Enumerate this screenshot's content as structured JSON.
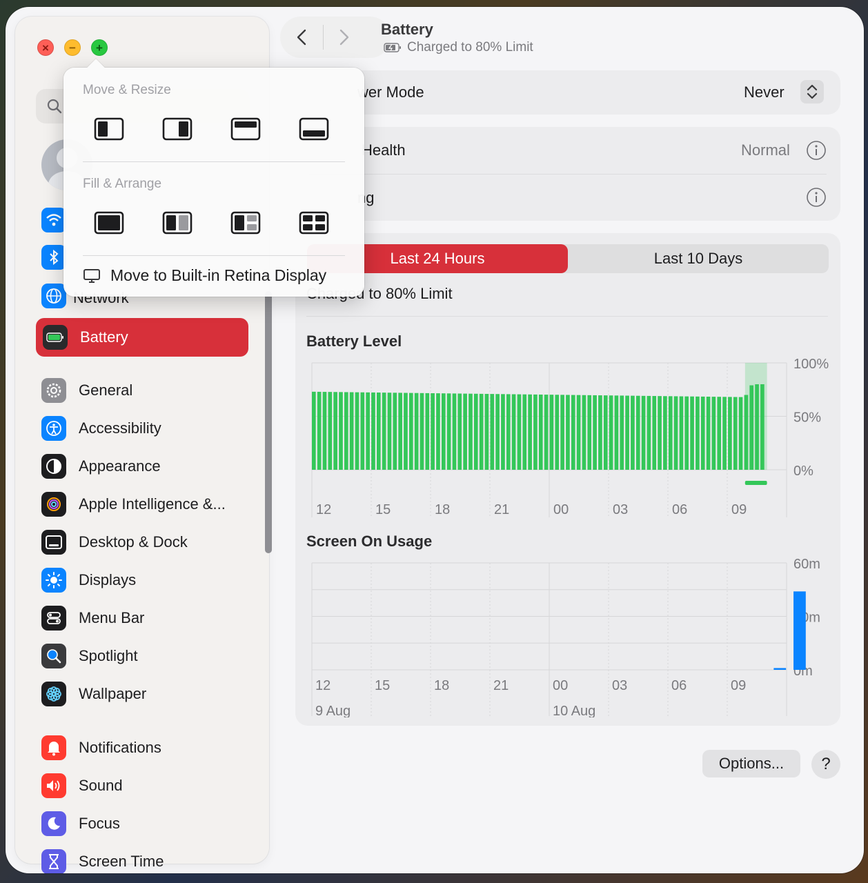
{
  "window": {
    "title": "Battery",
    "subtitle": "Charged to 80% Limit"
  },
  "sidebar": {
    "partial_item": "Network",
    "items": [
      {
        "label": "Battery",
        "icon": "battery-icon",
        "selected": true
      },
      {
        "label": "General",
        "icon": "gear-icon"
      },
      {
        "label": "Accessibility",
        "icon": "accessibility-icon"
      },
      {
        "label": "Appearance",
        "icon": "appearance-icon"
      },
      {
        "label": "Apple Intelligence &...",
        "icon": "apple-intelligence-icon"
      },
      {
        "label": "Desktop & Dock",
        "icon": "desktop-dock-icon"
      },
      {
        "label": "Displays",
        "icon": "displays-icon"
      },
      {
        "label": "Menu Bar",
        "icon": "menu-bar-icon"
      },
      {
        "label": "Spotlight",
        "icon": "spotlight-icon"
      },
      {
        "label": "Wallpaper",
        "icon": "wallpaper-icon"
      },
      {
        "label": "Notifications",
        "icon": "notifications-icon"
      },
      {
        "label": "Sound",
        "icon": "sound-icon"
      },
      {
        "label": "Focus",
        "icon": "focus-icon"
      },
      {
        "label": "Screen Time",
        "icon": "screen-time-icon"
      }
    ]
  },
  "settings": {
    "low_power_label": "wer Mode",
    "low_power_value": "Never",
    "health_label": "Health",
    "health_value": "Normal",
    "charging_label": "ng"
  },
  "tabs": {
    "active": "Last 24 Hours",
    "inactive": "Last 10 Days"
  },
  "status_text": "Charged to 80% Limit",
  "popover": {
    "move_resize": "Move & Resize",
    "fill_arrange": "Fill & Arrange",
    "move_display": "Move to Built-in Retina Display"
  },
  "chart_data": [
    {
      "type": "bar",
      "title": "Battery Level",
      "x_ticks": [
        "12",
        "15",
        "18",
        "21",
        "00",
        "03",
        "06",
        "09"
      ],
      "y_ticks": [
        "100%",
        "50%",
        "0%"
      ],
      "ylim": [
        0,
        100
      ],
      "bar_count": 80,
      "values_start": 73,
      "values_end": 68,
      "tail_values": [
        70,
        79,
        80,
        80
      ],
      "charging_highlight": "09",
      "color": "#34c759"
    },
    {
      "type": "bar",
      "title": "Screen On Usage",
      "x_ticks": [
        "12",
        "15",
        "18",
        "21",
        "00",
        "03",
        "06",
        "09"
      ],
      "date_labels": [
        "9 Aug",
        "10 Aug"
      ],
      "y_ticks": [
        "60m",
        "30m",
        "0m"
      ],
      "ylim": [
        0,
        60
      ],
      "bars": [
        {
          "slot": 23,
          "value": 1
        },
        {
          "slot": 24,
          "value": 44
        }
      ],
      "color": "#0a84ff"
    }
  ],
  "buttons": {
    "options": "Options...",
    "help": "?"
  },
  "colors": {
    "accent": "#d7303a",
    "battery_green": "#34c759",
    "usage_blue": "#0a84ff"
  }
}
